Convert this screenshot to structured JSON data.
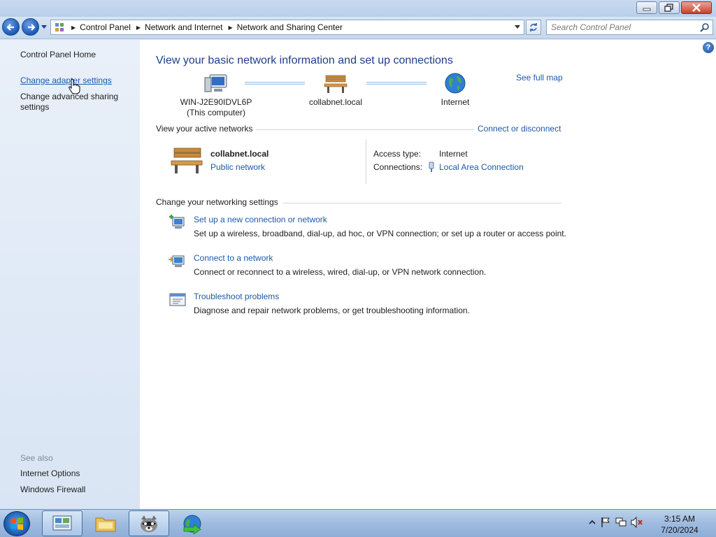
{
  "window": {
    "minimize_label": "",
    "maximize_label": "",
    "close_label": ""
  },
  "address_bar": {
    "breadcrumbs": [
      "Control Panel",
      "Network and Internet",
      "Network and Sharing Center"
    ]
  },
  "search": {
    "placeholder": "Search Control Panel"
  },
  "sidebar": {
    "home": "Control Panel Home",
    "links": [
      "Change adapter settings",
      "Change advanced sharing settings"
    ],
    "see_also_label": "See also",
    "see_also": [
      "Internet Options",
      "Windows Firewall"
    ]
  },
  "main": {
    "heading": "View your basic network information and set up connections",
    "see_full_map": "See full map",
    "map_nodes": [
      {
        "line1": "WIN-J2E90IDVL6P",
        "line2": "(This computer)"
      },
      {
        "line1": "collabnet.local",
        "line2": ""
      },
      {
        "line1": "Internet",
        "line2": ""
      }
    ],
    "active_networks": {
      "label": "View your active networks",
      "action": "Connect or disconnect",
      "network_name": "collabnet.local",
      "network_type": "Public network",
      "access_type_label": "Access type:",
      "access_type_value": "Internet",
      "connections_label": "Connections:",
      "connections_value": "Local Area Connection"
    },
    "settings": {
      "label": "Change your networking settings",
      "tasks": [
        {
          "title": "Set up a new connection or network",
          "desc": "Set up a wireless, broadband, dial-up, ad hoc, or VPN connection; or set up a router or access point."
        },
        {
          "title": "Connect to a network",
          "desc": "Connect or reconnect to a wireless, wired, dial-up, or VPN network connection."
        },
        {
          "title": "Troubleshoot problems",
          "desc": "Diagnose and repair network problems, or get troubleshooting information."
        }
      ]
    }
  },
  "taskbar": {
    "time": "3:15 AM",
    "date": "7/20/2024"
  },
  "icons": {
    "computer": "computer-icon",
    "bench": "park-bench-icon",
    "globe": "globe-icon",
    "help": "help-icon"
  }
}
